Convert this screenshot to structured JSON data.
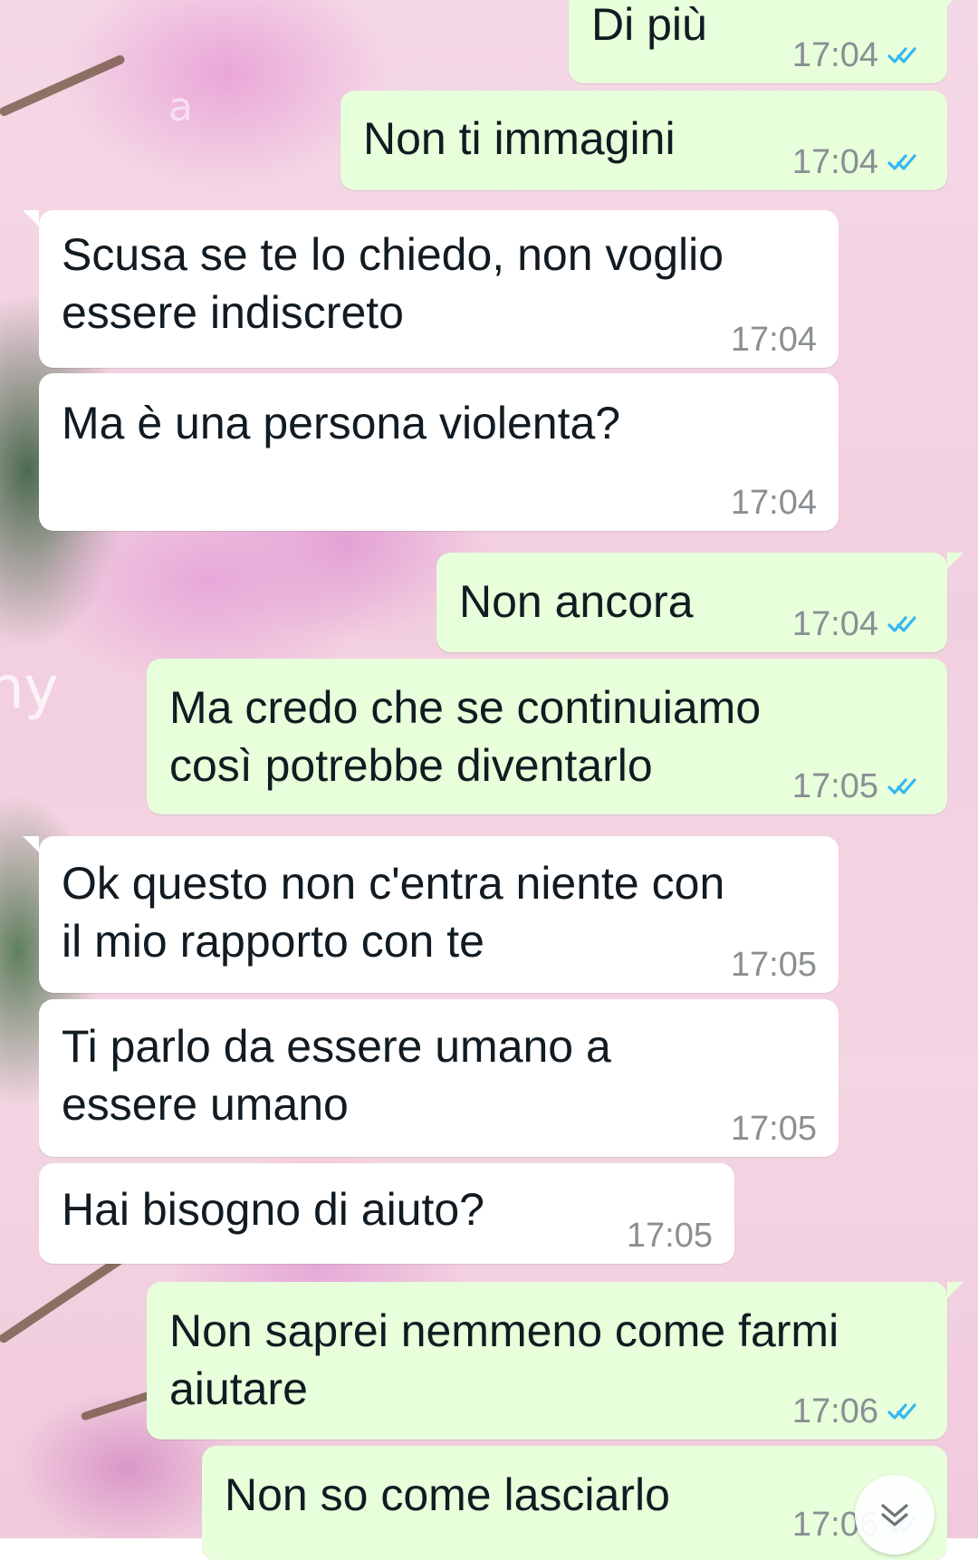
{
  "messages": [
    {
      "id": "m1",
      "direction": "outgoing",
      "text_lines": [
        "Di più"
      ],
      "time": "17:04",
      "read": true
    },
    {
      "id": "m2",
      "direction": "outgoing",
      "text_lines": [
        "Non ti immagini"
      ],
      "time": "17:04",
      "read": true
    },
    {
      "id": "m3",
      "direction": "incoming",
      "text_lines": [
        "Scusa se te lo chiedo, non voglio",
        "essere indiscreto"
      ],
      "time": "17:04"
    },
    {
      "id": "m4",
      "direction": "incoming",
      "text_lines": [
        "Ma è una persona violenta?"
      ],
      "time": "17:04"
    },
    {
      "id": "m5",
      "direction": "outgoing",
      "text_lines": [
        "Non ancora"
      ],
      "time": "17:04",
      "read": true
    },
    {
      "id": "m6",
      "direction": "outgoing",
      "text_lines": [
        "Ma credo che se continuiamo",
        "così potrebbe diventarlo"
      ],
      "time": "17:05",
      "read": true
    },
    {
      "id": "m7",
      "direction": "incoming",
      "text_lines": [
        "Ok questo non c'entra niente con",
        "il mio rapporto con te"
      ],
      "time": "17:05"
    },
    {
      "id": "m8",
      "direction": "incoming",
      "text_lines": [
        "Ti parlo da essere umano a",
        "essere umano"
      ],
      "time": "17:05"
    },
    {
      "id": "m9",
      "direction": "incoming",
      "text_lines": [
        "Hai bisogno di aiuto?"
      ],
      "time": "17:05"
    },
    {
      "id": "m10",
      "direction": "outgoing",
      "text_lines": [
        "Non saprei nemmeno come farmi",
        "aiutare"
      ],
      "time": "17:06",
      "read": true
    },
    {
      "id": "m11",
      "direction": "outgoing",
      "text_lines": [
        "Non so come lasciarlo"
      ],
      "time": "17:06",
      "read": true
    }
  ],
  "icons": {
    "read_receipt": "double-check-icon",
    "scroll_down": "chevron-down-icon"
  },
  "colors": {
    "outgoing_bubble": "#e7ffdb",
    "incoming_bubble": "#ffffff",
    "read_tick": "#34b7f1",
    "timestamp": "#8a8f93"
  },
  "wallpaper": {
    "watermark_large": "ny",
    "watermark_small": "a"
  }
}
